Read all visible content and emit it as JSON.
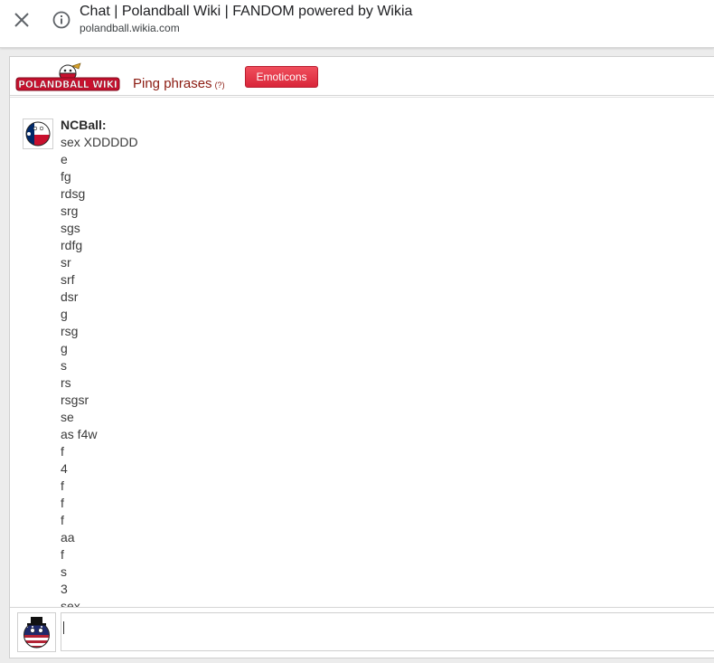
{
  "browser": {
    "title": "Chat | Polandball Wiki | FANDOM powered by Wikia",
    "url": "polandball.wikia.com"
  },
  "chat": {
    "logo_text": "POLANDBALL WIKI",
    "ping_label": "Ping phrases",
    "ping_help": "(?)",
    "emoticons_label": "Emoticons",
    "message": {
      "username": "NCBall:",
      "lines": [
        "sex XDDDDD",
        "e",
        "fg",
        "rdsg",
        "srg",
        "sgs",
        "rdfg",
        "sr",
        "srf",
        "dsr",
        "g",
        "rsg",
        "g",
        "s",
        "rs",
        "rsgsr",
        "se",
        "as f4w",
        "f",
        "4",
        "f",
        "f",
        "f",
        "aa",
        "f",
        "s",
        "3",
        "sex"
      ]
    },
    "input_value": ""
  },
  "colors": {
    "emoticons_button": "#e13447",
    "ping_text": "#8b1a10"
  }
}
